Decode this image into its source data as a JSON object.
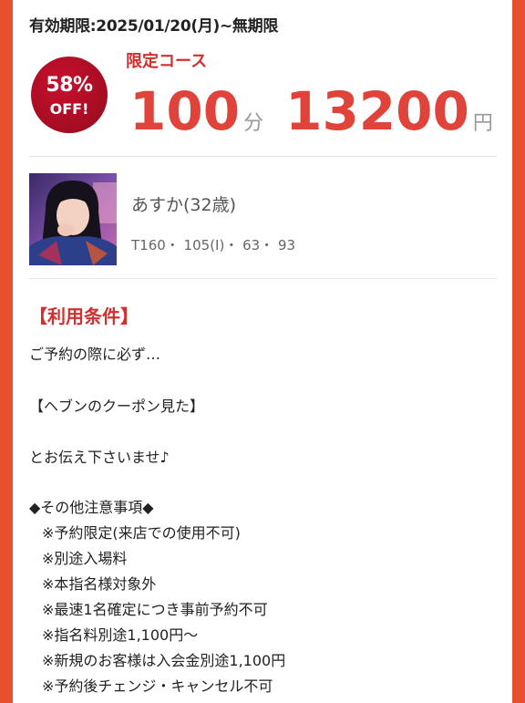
{
  "coupon": {
    "expiry": "有効期限:2025/01/20(月)~無期限",
    "discount_percent": "58%",
    "discount_off": "OFF!",
    "course_label": "限定コース",
    "duration_value": "100",
    "duration_unit": "分",
    "price_value": "13200",
    "price_unit": "円"
  },
  "cast": {
    "name": "あすか(32歳)",
    "measurements": "T160・ 105(I)・ 63・ 93"
  },
  "conditions": {
    "title": "【利用条件】",
    "line1": "ご予約の際に必ず…",
    "line2": "【ヘブンのクーポン見た】",
    "line3": "とお伝え下さいませ♪",
    "notes_title": "◆その他注意事項◆",
    "notes": [
      "※予約限定(来店での使用不可)",
      "※別途入場料",
      "※本指名様対象外",
      "※最速1名確定につき事前予約不可",
      "※指名料別途1,100円〜",
      "※新規のお客様は入会金別途1,100円",
      "※予約後チェンジ・キャンセル不可"
    ]
  },
  "colors": {
    "frame": "#e84f2c",
    "accent_red": "#d42f2f",
    "badge_red": "#c8102e"
  }
}
